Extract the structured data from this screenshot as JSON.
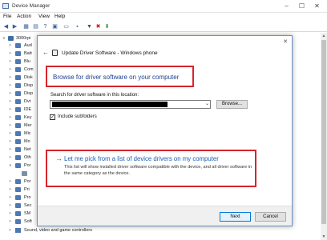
{
  "window": {
    "title": "Device Manager",
    "controls": {
      "minimize": "–",
      "maximize": "☐",
      "close": "✕"
    }
  },
  "menubar": [
    "File",
    "Action",
    "View",
    "Help"
  ],
  "toolbar": {
    "icons": [
      "back-icon",
      "forward-icon",
      "properties-icon",
      "update-driver-icon",
      "help-icon",
      "scan-icon",
      "monitor-icon",
      "add-device-icon",
      "disable-device-icon",
      "uninstall-icon",
      "download-icon"
    ]
  },
  "tree": {
    "root": {
      "label": "3000rpi",
      "expander": "∨"
    },
    "items": [
      {
        "label": "Aud",
        "expander": ">"
      },
      {
        "label": "Batt",
        "expander": ">"
      },
      {
        "label": "Blu",
        "expander": ">"
      },
      {
        "label": "Com",
        "expander": ">"
      },
      {
        "label": "Disk",
        "expander": ">"
      },
      {
        "label": "Disp",
        "expander": ">"
      },
      {
        "label": "Disp",
        "expander": ">"
      },
      {
        "label": "Dvt",
        "expander": ">"
      },
      {
        "label": "IDE",
        "expander": ">"
      },
      {
        "label": "Key",
        "expander": ">"
      },
      {
        "label": "Mer",
        "expander": ">"
      },
      {
        "label": "Mic",
        "expander": ">"
      },
      {
        "label": "Mo",
        "expander": ">"
      },
      {
        "label": "Net",
        "expander": ">"
      },
      {
        "label": "Oth",
        "expander": ">"
      },
      {
        "label": "Por",
        "expander": "∨"
      },
      {
        "label": "",
        "expander": ""
      },
      {
        "label": "Por",
        "expander": ">"
      },
      {
        "label": "Pri",
        "expander": ">"
      },
      {
        "label": "Pro",
        "expander": ">"
      },
      {
        "label": "Sec",
        "expander": ">"
      },
      {
        "label": "SM",
        "expander": ">"
      },
      {
        "label": "Soft",
        "expander": ">"
      }
    ],
    "bottom_item": {
      "label": "Sound, video and game controllers",
      "expander": ">"
    }
  },
  "scrollbar": {
    "up": "▲",
    "down": "▼"
  },
  "dialog": {
    "title": "Update Driver Software - Windows phone",
    "back": "←",
    "close": "✕",
    "heading": "Browse for driver software on your computer",
    "search_label": "Search for driver software in this location:",
    "path_value": "",
    "dropdown_caret": "⌄",
    "browse_button": "Browse...",
    "include_subfolders": {
      "label": "Include subfolders",
      "checked": true,
      "mark": "✓"
    },
    "pick_option": {
      "arrow": "→",
      "title": "Let me pick from a list of device drivers on my computer",
      "description": "This list will show installed driver software compatible with the device, and all driver software in the same category as the device."
    },
    "next_button": "Next",
    "cancel_button": "Cancel"
  },
  "colors": {
    "highlight_border": "#d6252c",
    "link_blue": "#1d5fb4",
    "heading_blue": "#1d3f8f",
    "default_button_border": "#0078d7"
  }
}
